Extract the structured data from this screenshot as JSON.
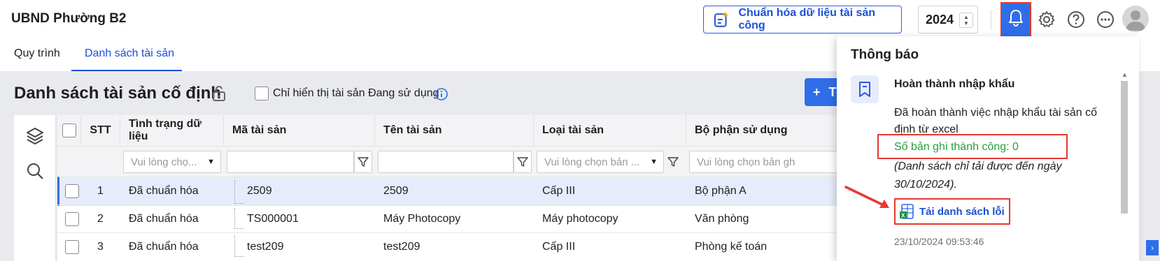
{
  "header": {
    "app_title": "UBND Phường B2",
    "normalize_button": "Chuẩn hóa dữ liệu tài sản công",
    "year": "2024"
  },
  "tabs": [
    {
      "label": "Quy trình"
    },
    {
      "label": "Danh sách tài sản"
    }
  ],
  "page": {
    "title": "Danh sách tài sản cố định",
    "filter_label": "Chỉ hiển thị tài sản Đang sử dụng",
    "add_button": "T"
  },
  "table": {
    "columns": [
      "STT",
      "Tình trạng dữ liệu",
      "Mã tài sản",
      "Tên tài sản",
      "Loại tài sản",
      "Bộ phận sử dụng"
    ],
    "filters": {
      "status_placeholder": "Vui lòng chọ...",
      "type_placeholder": "Vui lòng chọn bản ...",
      "dept_placeholder": "Vui lòng chọn bản gh"
    },
    "rows": [
      {
        "stt": "1",
        "status": "Đã chuẩn hóa",
        "code": "2509",
        "name": "2509",
        "type": "Cấp III",
        "dept": "Bộ phận A"
      },
      {
        "stt": "2",
        "status": "Đã chuẩn hóa",
        "code": "TS000001",
        "name": "Máy Photocopy",
        "type": "Máy photocopy",
        "dept": "Văn phòng"
      },
      {
        "stt": "3",
        "status": "Đã chuẩn hóa",
        "code": "test209",
        "name": "test209",
        "type": "Cấp III",
        "dept": "Phòng kế toán"
      }
    ]
  },
  "notification": {
    "title": "Thông báo",
    "item_title": "Hoàn thành nhập khẩu",
    "body": "Đã hoàn thành việc nhập khẩu tài sản cố định từ excel",
    "success": "Số bản ghi thành công: 0",
    "note": "(Danh sách chỉ tải được đến ngày 30/10/2024).",
    "download_link": "Tải danh sách lỗi",
    "timestamp": "23/10/2024 09:53:46"
  },
  "colors": {
    "accent": "#2f6ee8",
    "link": "#1d4fd6",
    "success": "#23a23c",
    "highlight_outline": "#e53935"
  }
}
